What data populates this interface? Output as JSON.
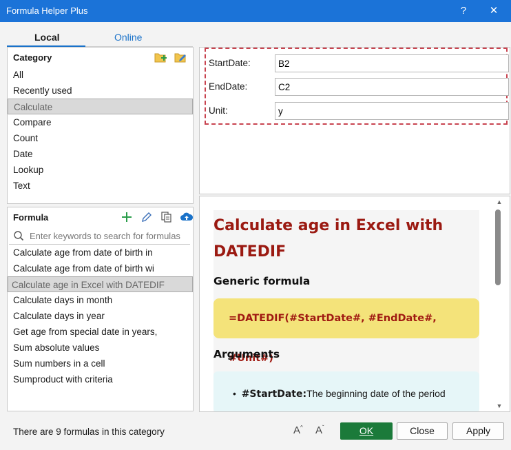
{
  "window": {
    "title": "Formula Helper Plus",
    "help_label": "?",
    "close_label": "✕"
  },
  "tabs": [
    {
      "label": "Local"
    },
    {
      "label": "Online"
    }
  ],
  "category": {
    "header": "Category",
    "items": [
      "All",
      "Recently used",
      "Calculate",
      "Compare",
      "Count",
      "Date",
      "Lookup",
      "Text"
    ],
    "selected": "Calculate"
  },
  "formula": {
    "header": "Formula",
    "search_placeholder": "Enter keywords to search for formulas",
    "items": [
      "Calculate age from date of birth in",
      "Calculate age from date of birth wi",
      "Calculate age in Excel with DATEDIF",
      "Calculate days in month",
      "Calculate days in year",
      "Get age from special date in years,",
      "Sum absolute values",
      "Sum numbers in a cell",
      "Sumproduct with criteria"
    ],
    "selected": "Calculate age in Excel with DATEDIF"
  },
  "arguments": [
    {
      "label": "StartDate:",
      "value": "B2"
    },
    {
      "label": "EndDate:",
      "value": "C2"
    },
    {
      "label": "Unit:",
      "value": "y"
    }
  ],
  "doc": {
    "title": "Calculate age in Excel with DATEDIF",
    "generic_heading": "Generic formula",
    "formula": "=DATEDIF(#StartDate#, #EndDate#, #Unit#)",
    "arguments_heading": "Arguments",
    "bullet_term": "#StartDate:",
    "bullet_text": "The beginning date of the period"
  },
  "footer": {
    "status": "There are 9 formulas in this category",
    "font_increase": "A",
    "font_decrease": "A",
    "ok_label": "OK",
    "close_label": "Close",
    "apply_label": "Apply"
  },
  "colors": {
    "titlebar": "#1b73d8",
    "accent": "#1a72c9",
    "doc_title": "#9b1a12",
    "formula_bg": "#f4e37a",
    "ok_button": "#1b7a3a",
    "args_border": "#c8434f"
  }
}
